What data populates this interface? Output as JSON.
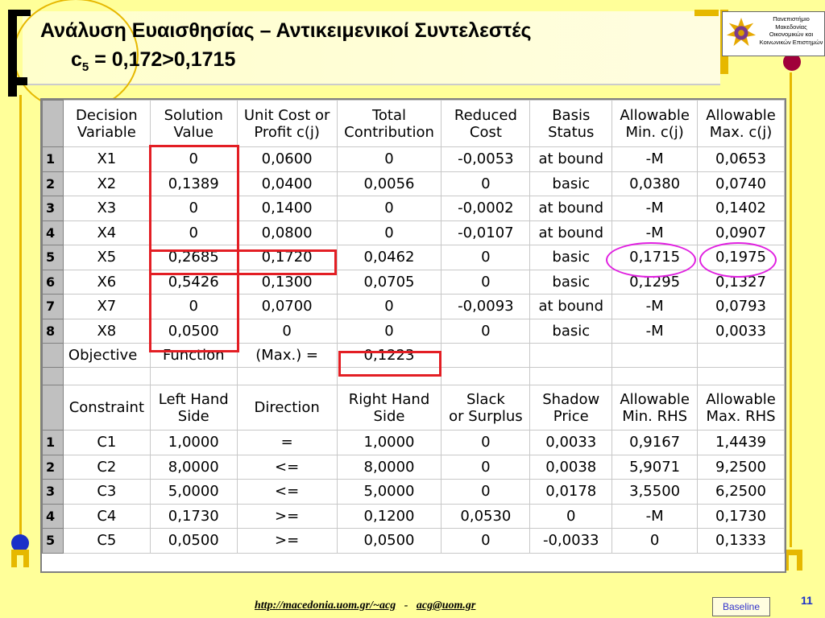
{
  "title": {
    "line1": "Ανάλυση Ευαισθησίας – Αντικειμενικοί Συντελεστές",
    "line2_var": "c",
    "line2_sub": "5",
    "line2_rest": " = 0,172>0,1715"
  },
  "logo": {
    "lines": [
      "Πανεπιστήμιο",
      "Μακεδονίας",
      "Οικονομικών και",
      "Κοινωνικών Επιστημών"
    ]
  },
  "table1": {
    "headers": [
      [
        "Decision",
        "Variable"
      ],
      [
        "Solution",
        "Value"
      ],
      [
        "Unit Cost or",
        "Profit c(j)"
      ],
      [
        "Total",
        "Contribution"
      ],
      [
        "Reduced",
        "Cost"
      ],
      [
        "Basis",
        "Status"
      ],
      [
        "Allowable",
        "Min. c(j)"
      ],
      [
        "Allowable",
        "Max. c(j)"
      ]
    ],
    "rows": [
      [
        "1",
        "X1",
        "0",
        "0,0600",
        "0",
        "-0,0053",
        "at bound",
        "-M",
        "0,0653"
      ],
      [
        "2",
        "X2",
        "0,1389",
        "0,0400",
        "0,0056",
        "0",
        "basic",
        "0,0380",
        "0,0740"
      ],
      [
        "3",
        "X3",
        "0",
        "0,1400",
        "0",
        "-0,0002",
        "at bound",
        "-M",
        "0,1402"
      ],
      [
        "4",
        "X4",
        "0",
        "0,0800",
        "0",
        "-0,0107",
        "at bound",
        "-M",
        "0,0907"
      ],
      [
        "5",
        "X5",
        "0,2685",
        "0,1720",
        "0,0462",
        "0",
        "basic",
        "0,1715",
        "0,1975"
      ],
      [
        "6",
        "X6",
        "0,5426",
        "0,1300",
        "0,0705",
        "0",
        "basic",
        "0,1295",
        "0,1327"
      ],
      [
        "7",
        "X7",
        "0",
        "0,0700",
        "0",
        "-0,0093",
        "at bound",
        "-M",
        "0,0793"
      ],
      [
        "8",
        "X8",
        "0,0500",
        "0",
        "0",
        "0",
        "basic",
        "-M",
        "0,0033"
      ]
    ],
    "objective": [
      "Objective",
      "Function",
      "(Max.) =",
      "0,1223"
    ]
  },
  "table2": {
    "headers": [
      [
        "Constraint"
      ],
      [
        "Left Hand",
        "Side"
      ],
      [
        "Direction"
      ],
      [
        "Right Hand",
        "Side"
      ],
      [
        "Slack",
        "or Surplus"
      ],
      [
        "Shadow",
        "Price"
      ],
      [
        "Allowable",
        "Min. RHS"
      ],
      [
        "Allowable",
        "Max. RHS"
      ]
    ],
    "rows": [
      [
        "1",
        "C1",
        "1,0000",
        "=",
        "1,0000",
        "0",
        "0,0033",
        "0,9167",
        "1,4439"
      ],
      [
        "2",
        "C2",
        "8,0000",
        "<=",
        "8,0000",
        "0",
        "0,0038",
        "5,9071",
        "9,2500"
      ],
      [
        "3",
        "C3",
        "5,0000",
        "<=",
        "5,0000",
        "0",
        "0,0178",
        "3,5500",
        "6,2500"
      ],
      [
        "4",
        "C4",
        "0,1730",
        ">=",
        "0,1200",
        "0,0530",
        "0",
        "-M",
        "0,1730"
      ],
      [
        "5",
        "C5",
        "0,0500",
        ">=",
        "0,0500",
        "0",
        "-0,0033",
        "0",
        "0,1333"
      ]
    ]
  },
  "footer": {
    "url": "http://macedonia.uom.gr/~acg",
    "sep": "-",
    "email": "acg@uom.gr",
    "baseline": "Baseline",
    "page": "11"
  },
  "colors": {
    "background": "#ffff99",
    "accent_gold": "#e6b800",
    "highlight_red": "#e31e24",
    "highlight_magenta": "#e020e0",
    "bullet_blue": "#1a2fc8",
    "bullet_maroon": "#a0003a"
  }
}
